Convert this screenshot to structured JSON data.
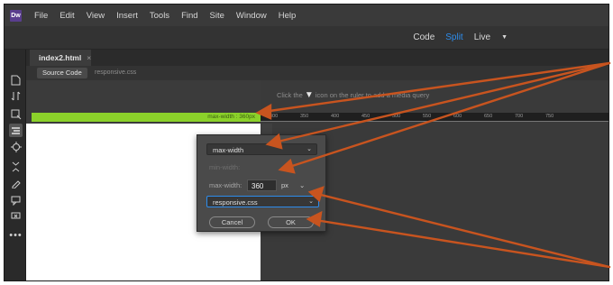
{
  "menu": {
    "logo": "Dw",
    "items": [
      "File",
      "Edit",
      "View",
      "Insert",
      "Tools",
      "Find",
      "Site",
      "Window",
      "Help"
    ]
  },
  "view_switch": {
    "code": "Code",
    "split": "Split",
    "live": "Live",
    "live_caret": "▼",
    "active": "Split"
  },
  "document": {
    "tab_label": "index2.html",
    "close": "×"
  },
  "related_files": {
    "source_code": "Source Code",
    "css_file": "responsive.css"
  },
  "hint": {
    "before": "Click the",
    "icon": "add-media-query-icon",
    "after": "icon on the ruler to add a media query"
  },
  "media_query_bar": {
    "label": "max-width : 360px",
    "color": "#8bd12a"
  },
  "ruler_ticks": [
    "300",
    "350",
    "400",
    "450",
    "500",
    "550",
    "600",
    "650",
    "700",
    "750"
  ],
  "dialog": {
    "condition_select": "max-width",
    "min_width_label": "min-width:",
    "max_width_label": "max-width:",
    "max_width_value": "360",
    "unit_select": "px",
    "file_select": "responsive.css",
    "cancel": "Cancel",
    "ok": "OK"
  },
  "colors": {
    "accent": "#2d8ceb",
    "annotation_arrow": "#c8541f"
  }
}
